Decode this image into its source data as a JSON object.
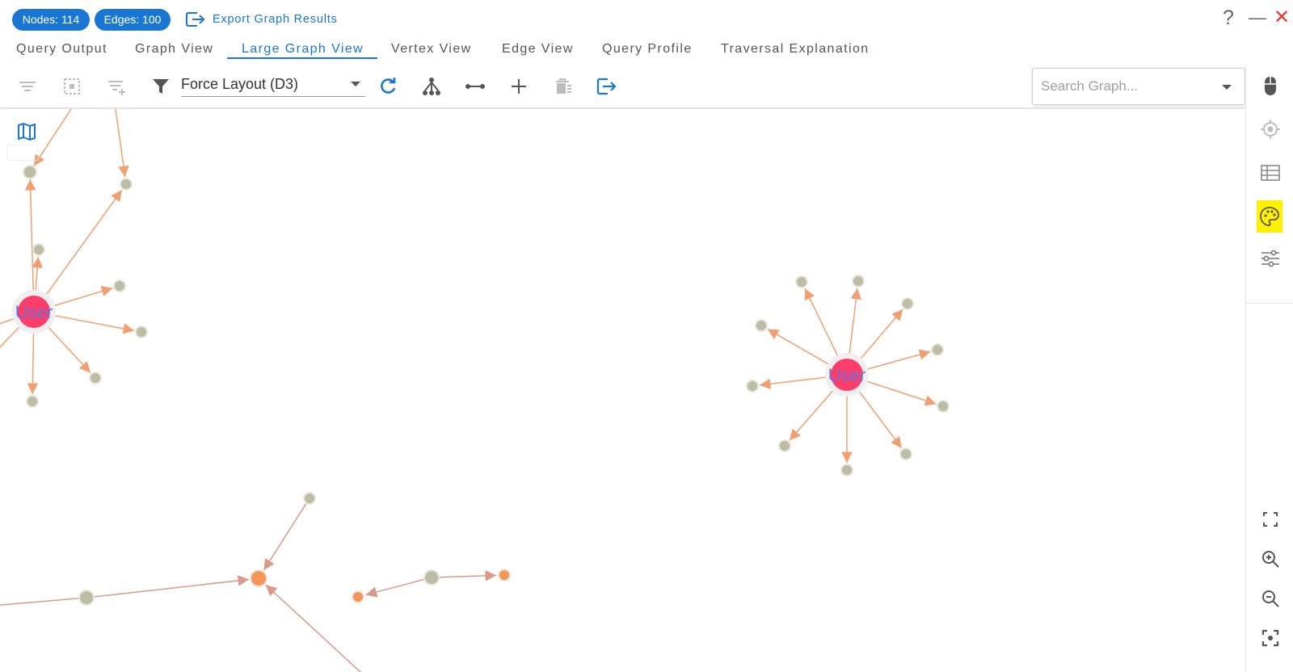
{
  "header": {
    "nodes_badge": "Nodes: 114",
    "edges_badge": "Edges: 100",
    "export_label": "Export Graph Results",
    "help_symbol": "?",
    "minimize_symbol": "—",
    "close_symbol": "✕"
  },
  "tabs": [
    {
      "label": "Query Output",
      "active": false
    },
    {
      "label": "Graph View",
      "active": false
    },
    {
      "label": "Large Graph View",
      "active": true
    },
    {
      "label": "Vertex View",
      "active": false
    },
    {
      "label": "Edge View",
      "active": false
    },
    {
      "label": "Query Profile",
      "active": false
    },
    {
      "label": "Traversal Explanation",
      "active": false
    }
  ],
  "toolbar": {
    "layout_value": "Force Layout (D3)",
    "search_placeholder": "Search Graph...",
    "icons": [
      "filter-list-icon",
      "select-region-icon",
      "filter-add-icon",
      "funnel-icon",
      "refresh-icon",
      "hierarchy-icon",
      "edge-length-icon",
      "add-icon",
      "delete-icon",
      "export-icon"
    ]
  },
  "side_panel": {
    "icons": [
      "mouse-icon",
      "target-icon",
      "table-icon",
      "palette-icon",
      "sliders-icon",
      "fullscreen-icon",
      "zoom-in-icon",
      "zoom-out-icon",
      "fit-view-icon"
    ],
    "highlighted": "palette-icon"
  },
  "graph": {
    "colors": {
      "hub_node": "#ff3d6b",
      "leaf_node": "#bdbca4",
      "orange_node": "#f5955a",
      "edge": "#f0a070",
      "edge_muted": "#d9998a",
      "label": "#6b6fd6",
      "accent": "#1976d2"
    },
    "hub_label": "User"
  }
}
